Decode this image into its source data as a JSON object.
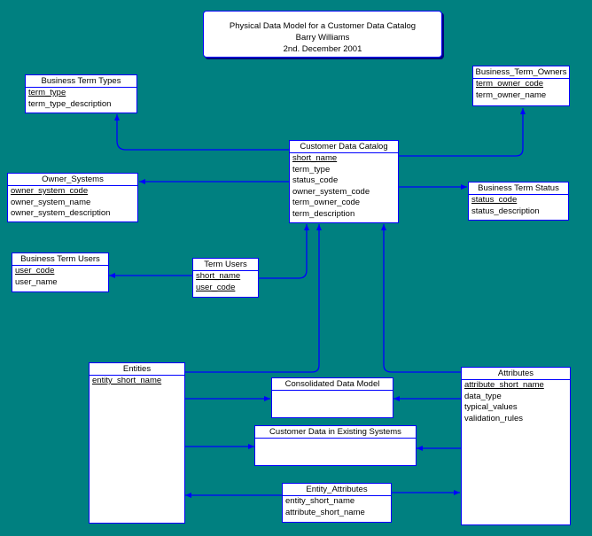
{
  "diagram": {
    "title_lines": [
      "Physical Data Model for a Customer Data Catalog",
      "Barry Williams",
      "2nd. December 2001"
    ],
    "colors": {
      "background": "#008080",
      "line": "#0000ff",
      "box": "#ffffff"
    },
    "entities": {
      "business_term_types": {
        "name": "Business Term Types",
        "attributes": [
          {
            "name": "term_type",
            "key": true
          },
          {
            "name": "term_type_description",
            "key": false
          }
        ]
      },
      "business_term_owners": {
        "name": "Business_Term_Owners",
        "attributes": [
          {
            "name": "term_owner_code",
            "key": true
          },
          {
            "name": "term_owner_name",
            "key": false
          }
        ]
      },
      "customer_data_catalog": {
        "name": "Customer Data Catalog",
        "attributes": [
          {
            "name": "short_name",
            "key": true
          },
          {
            "name": "term_type",
            "key": false
          },
          {
            "name": "status_code",
            "key": false
          },
          {
            "name": "owner_system_code",
            "key": false
          },
          {
            "name": "term_owner_code",
            "key": false
          },
          {
            "name": "term_description",
            "key": false
          }
        ]
      },
      "owner_systems": {
        "name": "Owner_Systems",
        "attributes": [
          {
            "name": "owner_system_code",
            "key": true
          },
          {
            "name": "owner_system_name",
            "key": false
          },
          {
            "name": "owner_system_description",
            "key": false
          }
        ]
      },
      "business_term_status": {
        "name": "Business Term Status",
        "attributes": [
          {
            "name": "status_code",
            "key": true
          },
          {
            "name": "status_description",
            "key": false
          }
        ]
      },
      "business_term_users": {
        "name": "Business Term Users",
        "attributes": [
          {
            "name": "user_code",
            "key": true
          },
          {
            "name": "user_name",
            "key": false
          }
        ]
      },
      "term_users": {
        "name": "Term Users",
        "attributes": [
          {
            "name": "short_name",
            "key": true
          },
          {
            "name": "user_code",
            "key": true
          }
        ]
      },
      "entities": {
        "name": "Entities",
        "attributes": [
          {
            "name": "entity_short_name",
            "key": true
          }
        ]
      },
      "consolidated_data_model": {
        "name": "Consolidated Data Model",
        "attributes": []
      },
      "customer_data_in_existing_systems": {
        "name": "Customer Data in Existing Systems",
        "attributes": []
      },
      "attributes": {
        "name": "Attributes",
        "attributes": [
          {
            "name": "attribute_short_name",
            "key": true
          },
          {
            "name": "data_type",
            "key": false
          },
          {
            "name": "typical_values",
            "key": false
          },
          {
            "name": "validation_rules",
            "key": false
          }
        ]
      },
      "entity_attributes": {
        "name": "Entity_Attributes",
        "attributes": [
          {
            "name": "entity_short_name",
            "key": false
          },
          {
            "name": "attribute_short_name",
            "key": false
          }
        ]
      }
    },
    "relationships": [
      {
        "from": "customer_data_catalog",
        "to": "business_term_types"
      },
      {
        "from": "customer_data_catalog",
        "to": "business_term_owners"
      },
      {
        "from": "customer_data_catalog",
        "to": "owner_systems"
      },
      {
        "from": "customer_data_catalog",
        "to": "business_term_status"
      },
      {
        "from": "term_users",
        "to": "business_term_users"
      },
      {
        "from": "term_users",
        "to": "customer_data_catalog"
      },
      {
        "from": "entities",
        "to": "customer_data_catalog"
      },
      {
        "from": "attributes",
        "to": "customer_data_catalog"
      },
      {
        "from": "entities",
        "to": "consolidated_data_model"
      },
      {
        "from": "attributes",
        "to": "consolidated_data_model"
      },
      {
        "from": "entities",
        "to": "customer_data_in_existing_systems"
      },
      {
        "from": "attributes",
        "to": "customer_data_in_existing_systems"
      },
      {
        "from": "entity_attributes",
        "to": "entities"
      },
      {
        "from": "entity_attributes",
        "to": "attributes"
      }
    ]
  }
}
